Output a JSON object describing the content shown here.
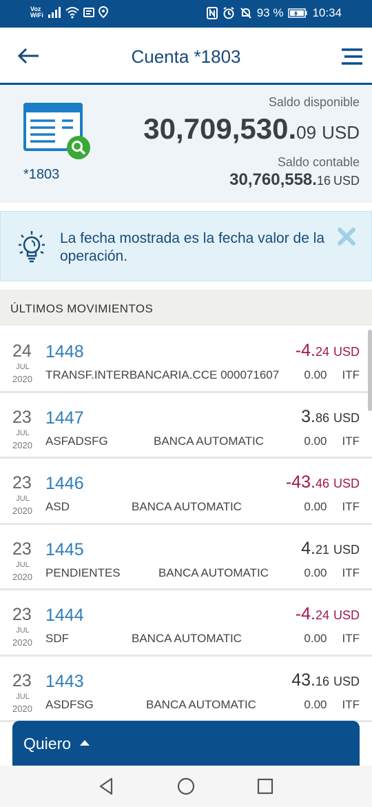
{
  "status_bar": {
    "voz_line1": "Voz",
    "voz_line2": "WiFi",
    "battery": "93 %",
    "time": "10:34"
  },
  "header": {
    "title": "Cuenta *1803"
  },
  "summary": {
    "account_label": "*1803",
    "available_label": "Saldo disponible",
    "available_int": "30,709,530.",
    "available_dec": "09",
    "available_cur": "USD",
    "book_label": "Saldo contable",
    "book_int": "30,760,558.",
    "book_dec": "16",
    "book_cur": "USD"
  },
  "info": {
    "text": "La fecha mostrada es la fecha valor de la operación."
  },
  "section": {
    "title": "ÚLTIMOS MOVIMIENTOS"
  },
  "movements": [
    {
      "day": "24",
      "month": "JUL",
      "year": "2020",
      "number": "1448",
      "description": "TRANSF.INTERBANCARIA.CCE 000071607",
      "channel": "",
      "amount_int": "-4.",
      "amount_dec": "24",
      "currency": "USD",
      "tax_amount": "0.00",
      "tax_label": "ITF",
      "negative": true
    },
    {
      "day": "23",
      "month": "JUL",
      "year": "2020",
      "number": "1447",
      "description": "ASFADSFG",
      "channel": "BANCA AUTOMATIC",
      "amount_int": "3.",
      "amount_dec": "86",
      "currency": "USD",
      "tax_amount": "0.00",
      "tax_label": "ITF",
      "negative": false
    },
    {
      "day": "23",
      "month": "JUL",
      "year": "2020",
      "number": "1446",
      "description": "ASD",
      "channel": "BANCA AUTOMATIC",
      "amount_int": "-43.",
      "amount_dec": "46",
      "currency": "USD",
      "tax_amount": "0.00",
      "tax_label": "ITF",
      "negative": true
    },
    {
      "day": "23",
      "month": "JUL",
      "year": "2020",
      "number": "1445",
      "description": "PENDIENTES",
      "channel": "BANCA AUTOMATIC",
      "amount_int": "4.",
      "amount_dec": "21",
      "currency": "USD",
      "tax_amount": "0.00",
      "tax_label": "ITF",
      "negative": false
    },
    {
      "day": "23",
      "month": "JUL",
      "year": "2020",
      "number": "1444",
      "description": "SDF",
      "channel": "BANCA AUTOMATIC",
      "amount_int": "-4.",
      "amount_dec": "24",
      "currency": "USD",
      "tax_amount": "0.00",
      "tax_label": "ITF",
      "negative": true
    },
    {
      "day": "23",
      "month": "JUL",
      "year": "2020",
      "number": "1443",
      "description": "ASDFSG",
      "channel": "BANCA AUTOMATIC",
      "amount_int": "43.",
      "amount_dec": "16",
      "currency": "USD",
      "tax_amount": "0.00",
      "tax_label": "ITF",
      "negative": false
    }
  ],
  "action": {
    "label": "Quiero"
  },
  "colors": {
    "brand_blue": "#0b4f8d",
    "link_blue": "#2f7db9",
    "negative": "#a3164f",
    "info_bg": "#e3f2f8"
  }
}
